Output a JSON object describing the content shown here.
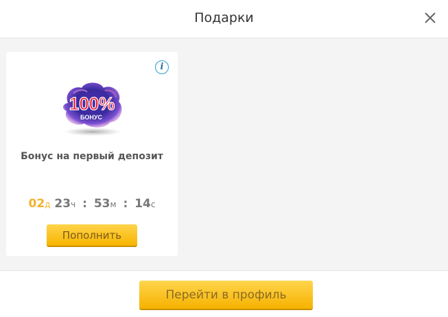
{
  "header": {
    "title": "Подарки",
    "close_icon": "close-icon"
  },
  "card": {
    "info_icon": "info-icon",
    "info_label": "i",
    "promo_image": {
      "big_text": "100%",
      "small_text": "БОНУС"
    },
    "title": "Бонус на первый депозит",
    "timer": {
      "days": "02",
      "days_unit": "д",
      "hours": "23",
      "hours_unit": "ч",
      "minutes": "53",
      "minutes_unit": "м",
      "seconds": "14",
      "seconds_unit": "с",
      "separator": ":"
    },
    "deposit_button": "Пополнить"
  },
  "footer": {
    "profile_button": "Перейти в профиль"
  },
  "colors": {
    "accent_yellow": "#f7b500",
    "days_color": "#f3b12b",
    "info_blue": "#2aa0d6",
    "background": "#f4f4f4"
  }
}
